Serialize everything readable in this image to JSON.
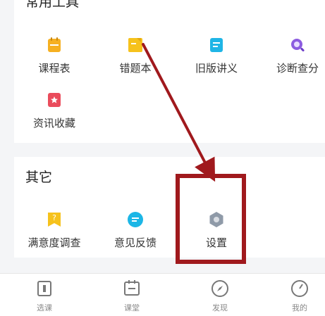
{
  "common_tools": {
    "title": "常用工具",
    "items": [
      {
        "label": "课程表",
        "icon": "calendar-icon",
        "color": "#f6b021"
      },
      {
        "label": "错题本",
        "icon": "notebook-icon",
        "color": "#f6c21c"
      },
      {
        "label": "旧版讲义",
        "icon": "document-icon",
        "color": "#1fb5e6"
      },
      {
        "label": "诊断查分",
        "icon": "magnifier-icon",
        "color": "#8c5ce0"
      },
      {
        "label": "资讯收藏",
        "icon": "star-bookmark-icon",
        "color": "#ea4c5c"
      }
    ]
  },
  "other": {
    "title": "其它",
    "items": [
      {
        "label": "满意度调查",
        "icon": "survey-icon",
        "color": "#f6c21c"
      },
      {
        "label": "意见反馈",
        "icon": "feedback-icon",
        "color": "#1cb6e6"
      },
      {
        "label": "设置",
        "icon": "settings-hexagon-icon",
        "color": "#8f9aa8"
      }
    ]
  },
  "tabbar": {
    "items": [
      {
        "label": "选课"
      },
      {
        "label": "课堂"
      },
      {
        "label": "发现"
      },
      {
        "label": "我的"
      }
    ]
  },
  "annotation": {
    "color": "#a0191d",
    "highlight_target": "设置"
  }
}
